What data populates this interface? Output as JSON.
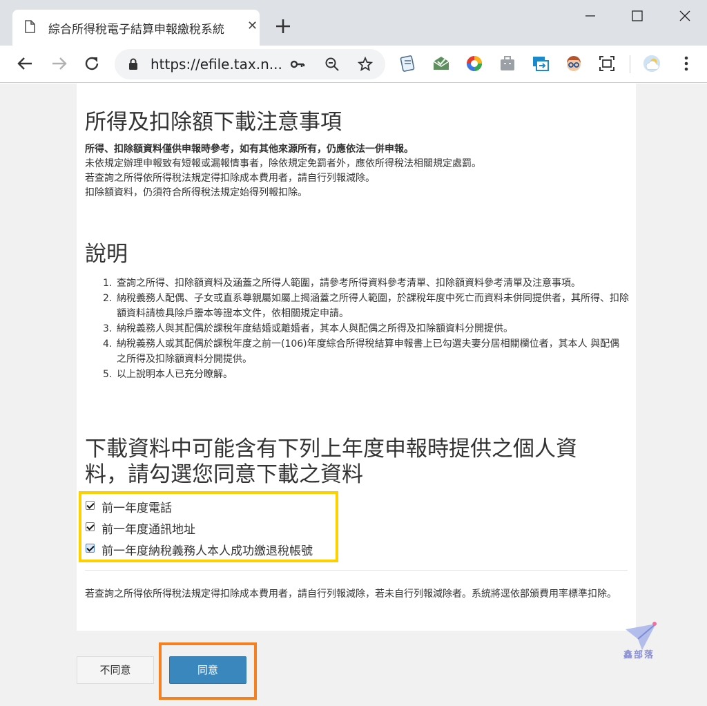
{
  "browser": {
    "tab_title": "綜合所得稅電子結算申報繳稅系統",
    "tab_close": "✕",
    "url": "https://efile.tax.n..."
  },
  "notice": {
    "heading": "所得及扣除額下載注意事項",
    "bold_line": "所得、扣除額資料僅供申報時參考，如有其他來源所有，仍應依法一併申報。",
    "lines": [
      "未依規定辦理申報致有短報或漏報情事者，除依規定免罰者外，應依所得稅法相關規定處罰。",
      "若查詢之所得依所得稅法規定得扣除成本費用者，請自行列報減除。",
      "扣除額資料，仍須符合所得稅法規定始得列報扣除。"
    ]
  },
  "explanation": {
    "heading": "說明",
    "items": [
      {
        "num": "1.",
        "text": "查詢之所得、扣除額資料及涵蓋之所得人範圍，請參考所得資料參考清單、扣除額資料參考清單及注意事項。"
      },
      {
        "num": "2.",
        "text": "納稅義務人配偶、子女或直系尊親屬如屬上揭涵蓋之所得人範圍，於課稅年度中死亡而資料未併同提供者，其所得、扣除額資料請檢具除戶謄本等證本文件，依相關規定申請。"
      },
      {
        "num": "3.",
        "text": "納稅義務人與其配偶於課稅年度結婚或離婚者，其本人與配偶之所得及扣除額資料分開提供。"
      },
      {
        "num": "4.",
        "text": "納稅義務人或其配偶於課稅年度之前一(106)年度綜合所得稅結算申報書上已勾選夫妻分居相關欄位者，其本人 與配偶之所得及扣除額資料分開提供。"
      },
      {
        "num": "5.",
        "text": "以上說明本人已充分瞭解。"
      }
    ]
  },
  "personal_data": {
    "heading_line1": "下載資料中可能含有下列上年度申報時提供之個人資",
    "heading_line2": "料，請勾選您同意下載之資料",
    "options": [
      {
        "label": "前一年度電話",
        "checked": true
      },
      {
        "label": "前一年度通訊地址",
        "checked": true
      },
      {
        "label": "前一年度納稅義務人本人成功繳退稅帳號",
        "checked": true
      }
    ]
  },
  "footnote": "若查詢之所得依所得稅法規定得扣除成本費用者，請自行列報減除，若未自行列報減除者。系統將逕依部頒費用率標準扣除。",
  "buttons": {
    "disagree": "不同意",
    "agree": "同意"
  },
  "watermark": "鑫部落",
  "colors": {
    "highlight_yellow": "#fdd000",
    "highlight_orange": "#f5801f",
    "agree_blue": "#3a87bd"
  }
}
